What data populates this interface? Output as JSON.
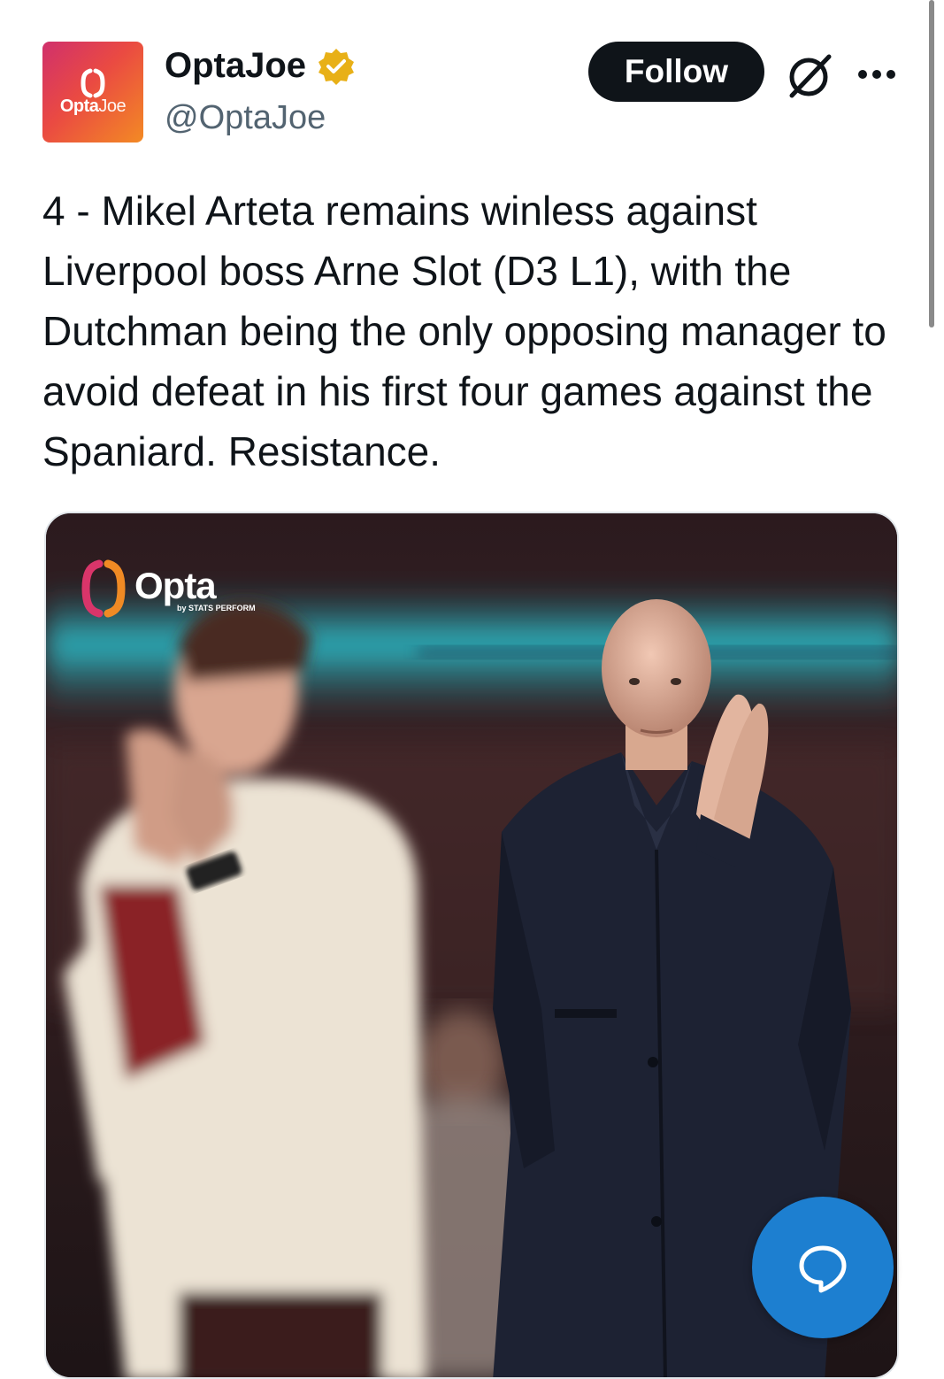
{
  "author": {
    "display_name": "OptaJoe",
    "handle": "@OptaJoe",
    "avatar_text_bold": "Opta",
    "avatar_text_light": "Joe",
    "verified_color": "#e8b017"
  },
  "actions": {
    "follow_label": "Follow",
    "grok_icon": "grok-icon",
    "more_icon": "more-icon"
  },
  "tweet": {
    "text": "4 - Mikel Arteta remains winless against Liverpool boss Arne Slot (D3 L1), with the Dutchman being the only opposing manager to avoid defeat in his first four games against the Spaniard. Resistance."
  },
  "media": {
    "logo_text": "Opta",
    "logo_subtext": "by STATS PERFORM"
  },
  "fab": {
    "icon": "reply-icon",
    "color": "#1d7fd0"
  }
}
